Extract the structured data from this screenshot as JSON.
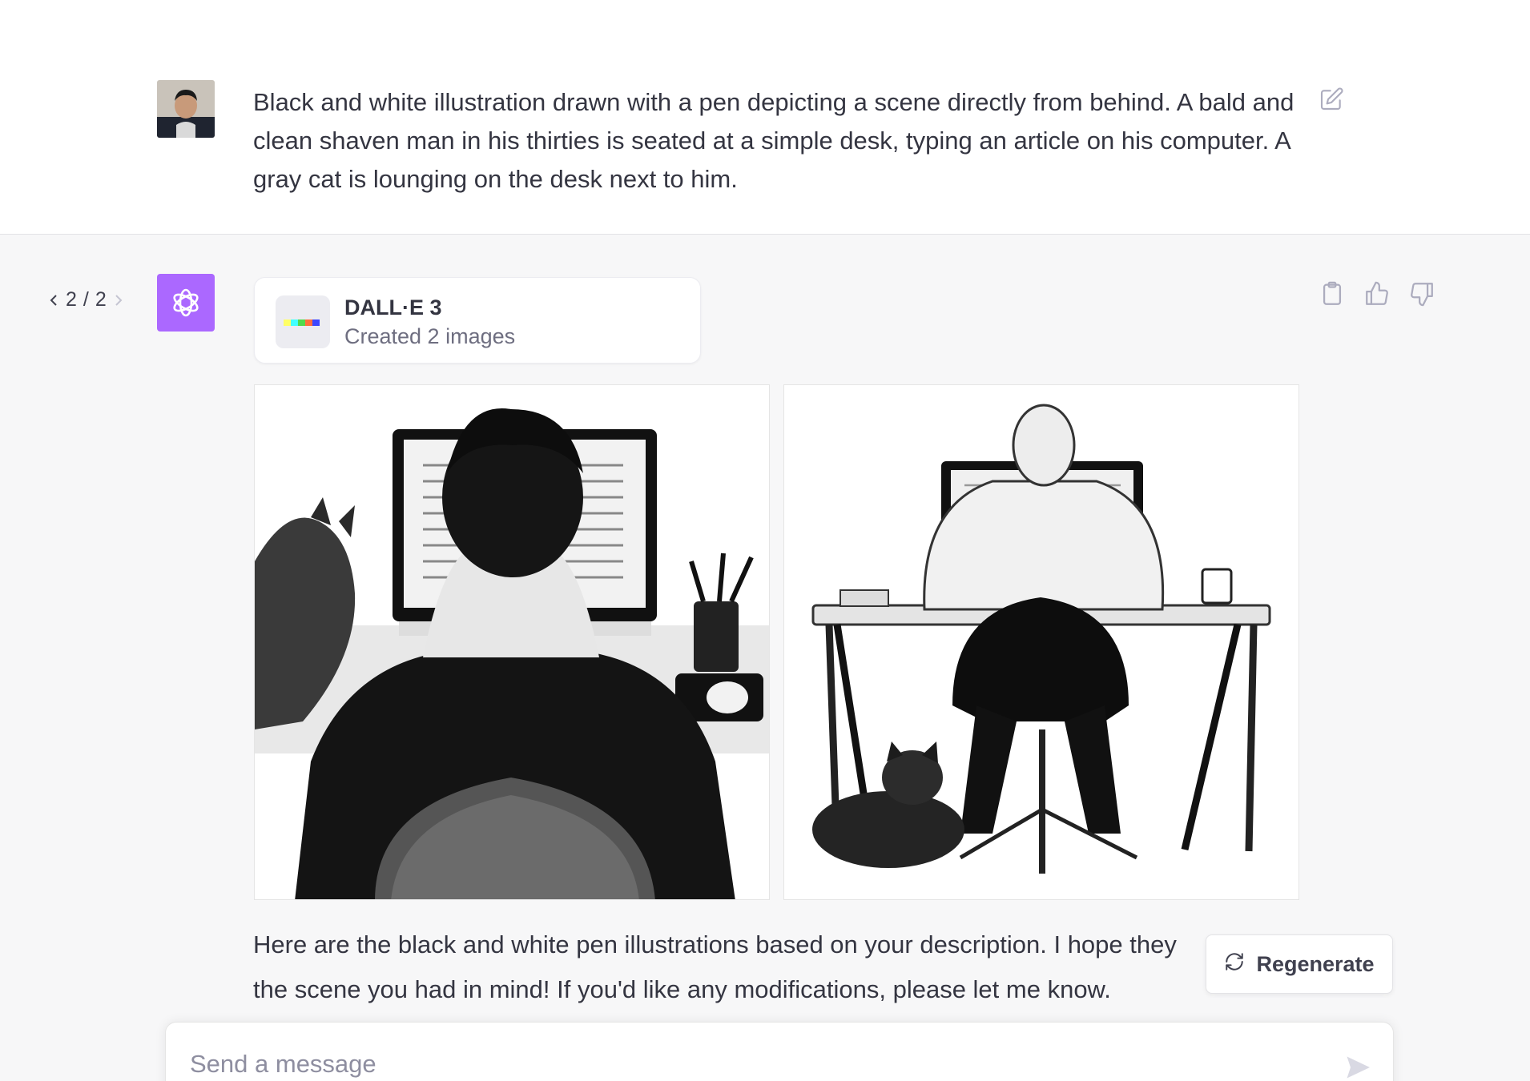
{
  "user_message": {
    "text": "Black and white illustration drawn with a pen depicting a scene directly from behind. A bald and clean shaven man in his thirties is seated at a simple desk, typing an article on his computer. A gray cat is lounging on the desk next to him.",
    "avatar_icon": "user-photo-avatar",
    "edit_icon": "edit-icon"
  },
  "assistant": {
    "pager": {
      "current": "2",
      "separator": "/",
      "total": "2"
    },
    "avatar_icon": "openai-logo-icon",
    "tool": {
      "name": "DALL·E 3",
      "status": "Created 2 images"
    },
    "actions": [
      "copy-icon",
      "thumbs-up-icon",
      "thumbs-down-icon"
    ],
    "images": [
      {
        "subject": "man-with-hair-at-desk-with-cat"
      },
      {
        "subject": "bald-man-at-desk-with-cat-on-floor"
      }
    ],
    "reply": "Here are the black and white pen illustrations based on your description. I hope they the scene you had in mind! If you'd like any modifications, please let me know."
  },
  "regenerate": {
    "label": "Regenerate"
  },
  "composer": {
    "placeholder": "Send a message"
  },
  "colors": {
    "accent": "#ab68ff",
    "text": "#343541",
    "muted": "#6e6e80"
  }
}
